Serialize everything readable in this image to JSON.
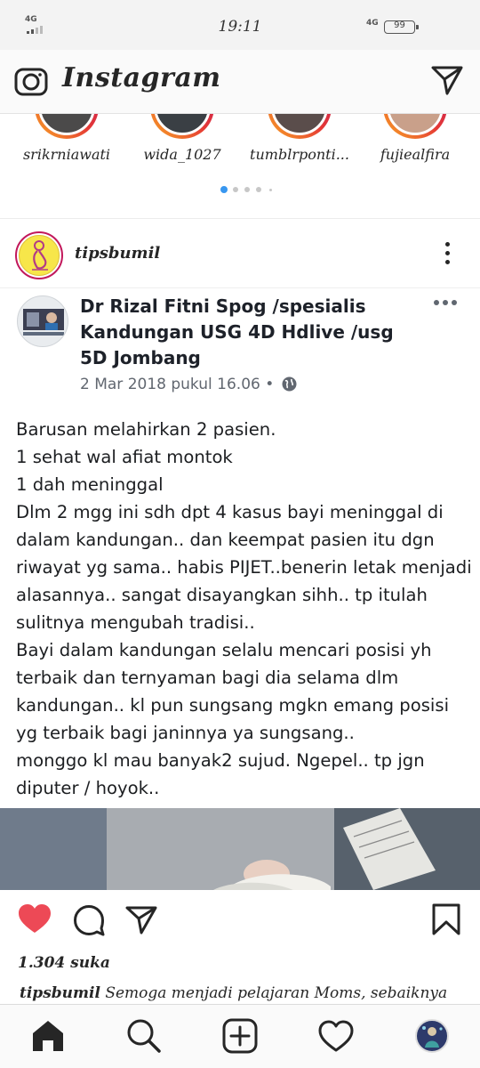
{
  "status_bar": {
    "network_left": "4G",
    "time": "19:11",
    "network_right": "4G",
    "battery": "99"
  },
  "header": {
    "logo": "Instagram",
    "camera_icon": "camera-icon",
    "direct_icon": "paper-plane-icon"
  },
  "stories": [
    {
      "username": "srikrniawati"
    },
    {
      "username": "wida_1027"
    },
    {
      "username": "tumblrponti..."
    },
    {
      "username": "fujiealfira"
    }
  ],
  "post": {
    "username": "tipsbumil",
    "embedded": {
      "page_name": "Dr Rizal Fitni Spog /spesialis Kandungan USG 4D Hdlive /usg 5D Jombang",
      "date": "2 Mar 2018 pukul 16.06 •",
      "body": "Barusan melahirkan 2 pasien.\n1 sehat wal afiat  montok\n1 dah meninggal\nDlm 2 mgg ini sdh dpt 4 kasus bayi meninggal di dalam kandungan.. dan keempat pasien itu dgn riwayat yg sama.. habis PIJET..benerin letak menjadi alasannya.. sangat disayangkan sihh.. tp itulah sulitnya mengubah tradisi..\nBayi dalam kandungan selalu mencari posisi yh terbaik dan ternyaman bagi dia selama dlm kandungan.. kl pun sungsang mgkn emang posisi yg terbaik bagi janinnya ya sungsang..\nmonggo kl mau banyak2 sujud. Ngepel.. tp jgn diputer / hoyok.."
    },
    "likes": "1.304 suka",
    "caption_user": "tipsbumil",
    "caption_text": "Semoga menjadi pelajaran Moms, sebaiknya",
    "like_color": "#ed4956"
  },
  "bottom_nav": {
    "items": [
      "home-icon",
      "search-icon",
      "add-icon",
      "heart-icon",
      "profile-avatar"
    ]
  }
}
